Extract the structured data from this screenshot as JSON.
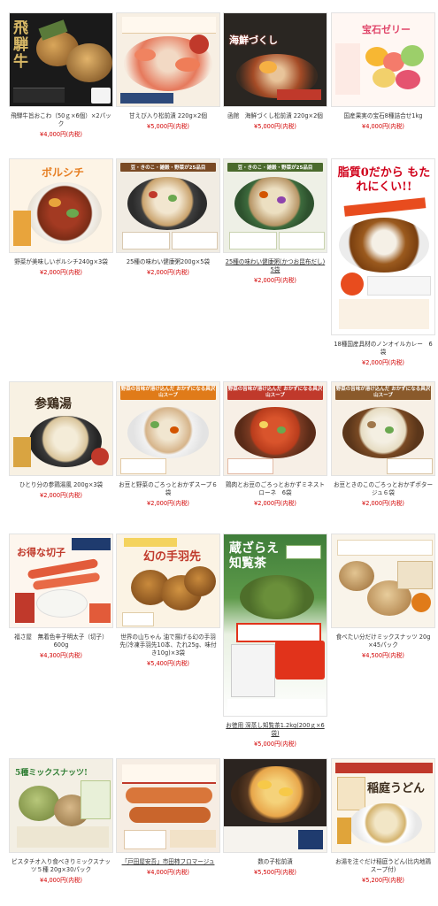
{
  "products": [
    {
      "name": "飛騨牛旨おこわ（50ｇ×6個）×2パック",
      "price": "¥4,000円(内税)",
      "img_text": "飛騨牛"
    },
    {
      "name": "甘えび入り松前漬 220g×2個",
      "price": "¥5,000円(内税)",
      "img_text": ""
    },
    {
      "name": "函館　海鮮づくし松前漬 220g×2個",
      "price": "¥5,000円(内税)",
      "img_text": "海鮮づくし"
    },
    {
      "name": "国産果実の宝石8種詰合せ1kg",
      "price": "¥4,000円(内税)",
      "img_text": "宝石ゼリー"
    },
    {
      "name": "野菜が美味しいボルシチ240g×3袋",
      "price": "¥2,000円(内税)",
      "img_text": "ボルシチ"
    },
    {
      "name": "25種の味わい健康粥200g×5袋",
      "price": "¥2,000円(内税)",
      "img_text": "豆・きのこ・雑穀・野菜が25品目"
    },
    {
      "name": "25種の味わい健康粥(かつお昆布だし) 5袋",
      "price": "¥2,000円(内税)",
      "img_text": "豆・きのこ・雑穀・野菜が25品目"
    },
    {
      "name": "18種国産具材のノンオイルカレー　6袋",
      "price": "¥2,000円(内税)",
      "img_text": "脂質0だから もたれにくい!!"
    },
    {
      "name": "ひとり分の参鶏湯風 200g×3袋",
      "price": "¥2,000円(内税)",
      "img_text": "参鶏湯"
    },
    {
      "name": "お豆と野菜のごろっとおかずスープ６袋",
      "price": "¥2,000円(内税)",
      "img_text": "野菜の旨味が溶け込んだ おかずになる具沢山スープ"
    },
    {
      "name": "鶏肉とお豆のごろっとおかずミネストローネ　6袋",
      "price": "¥2,000円(内税)",
      "img_text": "野菜の旨味が溶け込んだ おかずになる具沢山スープ"
    },
    {
      "name": "お豆ときのこのごろっとおかずポタージュ６袋",
      "price": "¥2,000円(内税)",
      "img_text": "野菜の旨味が溶け込んだ おかずになる具沢山スープ"
    },
    {
      "name": "福さ屋　無着色辛子明太子（切子）600g",
      "price": "¥4,300円(内税)",
      "img_text": "お得な切子"
    },
    {
      "name": "世界の山ちゃん 油で揚げる幻の手羽先(冷凍手羽先10本、たれ25g、味付き10g)×3袋",
      "price": "¥5,400円(内税)",
      "img_text": "幻の手羽先"
    },
    {
      "name": "お徳用 深蒸し知覧茶1.2kg(200ｇ×6袋)",
      "price": "¥5,000円(内税)",
      "img_text": "蔵ざらえ 知覧茶"
    },
    {
      "name": "食べたい分だけミックスナッツ 20g ×45パック",
      "price": "¥4,500円(内税)",
      "img_text": ""
    },
    {
      "name": "ピスタチオ入り食べきりミックスナッツ５種 20g×30パック",
      "price": "¥4,000円(内税)",
      "img_text": "5種ミックスナッツ!"
    },
    {
      "name": "「戸田屋安吾」市田柿フロマージュ",
      "price": "¥4,000円(内税)",
      "img_text": ""
    },
    {
      "name": "数の子松前漬",
      "price": "¥5,500円(内税)",
      "img_text": ""
    },
    {
      "name": "お湯を注ぐだけ稲庭うどん(比内地鶏スープ付)",
      "price": "¥5,200円(内税)",
      "img_text": "稲庭うどん"
    }
  ]
}
